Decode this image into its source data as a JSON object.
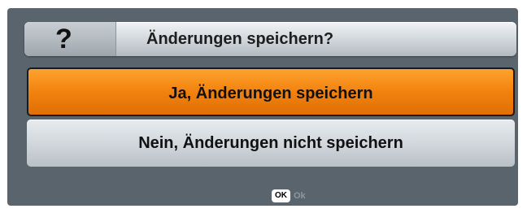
{
  "dialog": {
    "title_icon": "?",
    "title": "Änderungen speichern?",
    "options": [
      {
        "label": "Ja, Änderungen speichern",
        "selected": true
      },
      {
        "label": "Nein, Änderungen nicht speichern",
        "selected": false
      }
    ],
    "footer": {
      "key": "OK",
      "label": "Ok"
    }
  },
  "colors": {
    "background": "#5a646c",
    "selected_option": "#f2820e",
    "option": "#cdd3d8"
  },
  "icons": {
    "title_icon": "question-mark-icon"
  }
}
